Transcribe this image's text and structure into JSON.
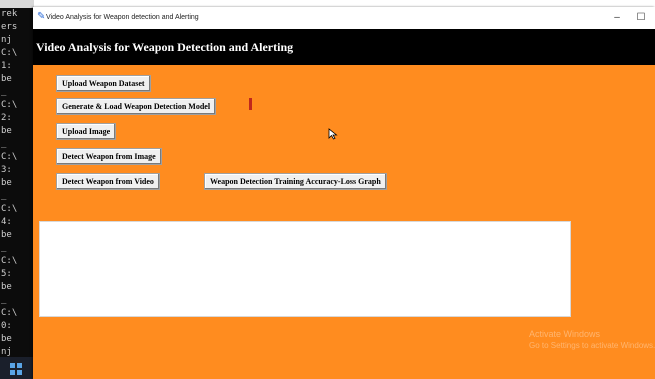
{
  "console": {
    "lines": [
      "rek",
      "ers",
      "nj",
      "C:\\",
      "1:",
      "be",
      "_",
      "C:\\",
      "2:",
      "be",
      "_",
      "C:\\",
      "3:",
      "be",
      "_",
      "C:\\",
      "4:",
      "be",
      "_",
      "C:\\",
      "5:",
      "be",
      "_",
      "C:\\",
      "0:",
      "be",
      "nj"
    ]
  },
  "window": {
    "title": "Video Analysis for Weapon detection and Alerting",
    "minimize_glyph": "–",
    "maximize_glyph": "☐",
    "heading": "Video Analysis for Weapon Detection and Alerting"
  },
  "buttons": {
    "upload_dataset": "Upload Weapon Dataset",
    "generate_model": "Generate & Load Weapon Detection Model",
    "upload_image": "Upload Image",
    "detect_image": "Detect Weapon from Image",
    "detect_video": "Detect Weapon from Video",
    "graph": "Weapon Detection Training Accuracy-Loss Graph"
  },
  "output": {
    "text": ""
  },
  "watermark": {
    "line1": "Activate Windows",
    "line2": "Go to Settings to activate Windows."
  },
  "colors": {
    "window_bg": "#ff8c1f",
    "heading_bg": "#000000",
    "heading_text": "#ffffff"
  },
  "icons": {
    "app_icon": "feather-icon",
    "mouse": "mouse-pointer-icon",
    "text_cursor": "text-cursor-icon",
    "start": "windows-logo-icon"
  }
}
